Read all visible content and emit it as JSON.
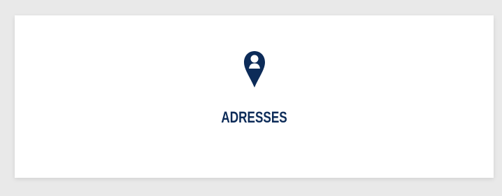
{
  "card": {
    "label": "ADRESSES",
    "icon": "map-pin-person-icon",
    "color": "#0c2b58"
  }
}
